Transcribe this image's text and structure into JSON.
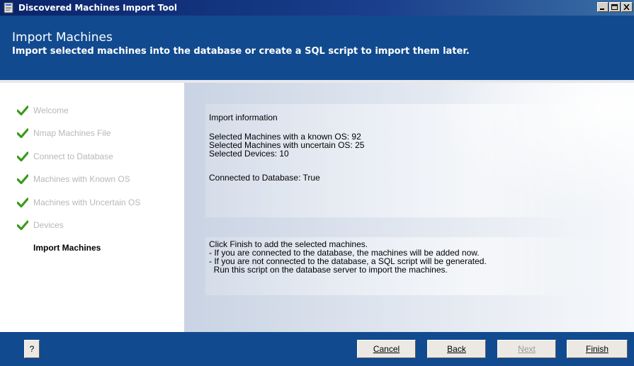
{
  "window": {
    "title": "Discovered Machines Import Tool"
  },
  "header": {
    "title": "Import Machines",
    "subtitle": "Import selected machines into the database or create a SQL script to import them later."
  },
  "sidebar": {
    "steps": [
      {
        "label": "Welcome",
        "completed": true
      },
      {
        "label": "Nmap Machines File",
        "completed": true
      },
      {
        "label": "Connect to Database",
        "completed": true
      },
      {
        "label": "Machines with Known OS",
        "completed": true
      },
      {
        "label": "Machines with Uncertain OS",
        "completed": true
      },
      {
        "label": "Devices",
        "completed": true
      },
      {
        "label": "Import Machines",
        "completed": false,
        "current": true
      }
    ]
  },
  "content": {
    "info_heading": "Import information",
    "known_os": "Selected Machines with a known OS: 92",
    "uncertain_os": "Selected Machines with uncertain OS: 25",
    "devices": "Selected Devices: 10",
    "connected": "Connected to Database: True",
    "instructions": [
      "Click Finish to add the selected machines.",
      "- If you are connected to the database, the machines will be added now.",
      "- If you are not connected to the database, a SQL script will be generated.",
      "  Run this script on the database server to import the machines."
    ]
  },
  "footer": {
    "help_label": "?",
    "cancel_label": "Cancel",
    "back_label": "Back",
    "next_label": "Next",
    "next_disabled": true,
    "finish_label": "Finish"
  },
  "colors": {
    "header_blue": "#114a8f",
    "check_green": "#3a9a1a",
    "disabled_text": "#b8b8b8"
  },
  "icons": [
    "app-icon",
    "minimize-icon",
    "maximize-icon",
    "close-icon",
    "check-icon"
  ]
}
